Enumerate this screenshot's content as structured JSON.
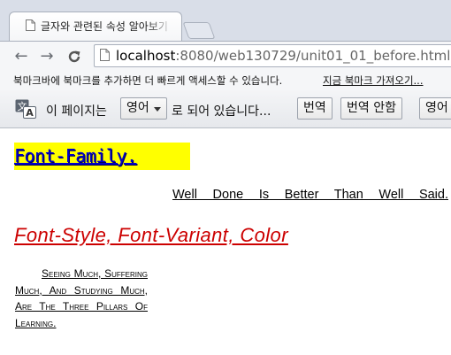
{
  "tab": {
    "title": "글자와 관련된 속성 알아보기"
  },
  "toolbar": {
    "back_icon": "arrow-left-icon",
    "forward_icon": "arrow-right-icon",
    "reload_icon": "reload-icon",
    "url_host": "localhost",
    "url_rest": ":8080/web130729/unit01_01_before.html"
  },
  "bookmarks": {
    "message": "북마크바에 북마크를 추가하면 더 빠르게 액세스할 수 있습니다.",
    "import_link": "지금 북마크 가져오기..."
  },
  "translate": {
    "prefix": "이 페이지는",
    "language": "영어",
    "suffix": "로 되어 있습니다...",
    "translate_button": "번역",
    "no_translate_button": "번역 안함",
    "more_button": "영어"
  },
  "page": {
    "font_family_title": "Font-Family.",
    "quote1": "Well Done Is Better Than Well Said.",
    "font_style_title": "Font-Style, Font-Variant, Color",
    "quote2": "Seeing Much, Suffering Much, And Studying Much, Are The Three Pillars Of Learning."
  },
  "colors": {
    "title_bg": "#ffff00",
    "title_text": "#0000cc",
    "style_title_text": "#cc0000"
  }
}
